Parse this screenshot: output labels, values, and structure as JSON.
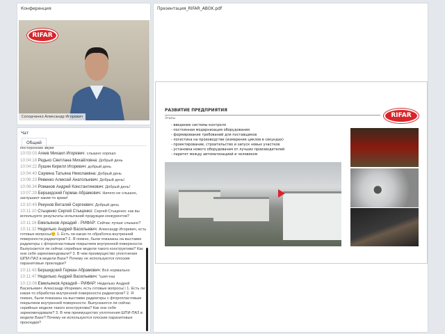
{
  "conference": {
    "title": "Конференция",
    "speaker": "Солодченко Александр Игоревич",
    "logo": "RIFAR"
  },
  "chat": {
    "title": "Чат",
    "tab": "Общий",
    "top_fragment": "посторонние звуки",
    "messages": [
      {
        "time": "10:03:03",
        "name": "Агеев Михаил Игоревич:",
        "text": "слышно хорошо"
      },
      {
        "time": "10:04:18",
        "name": "Редько Светлана Михайловна:",
        "text": "Добрый день"
      },
      {
        "time": "10:04:22",
        "name": "Лушин Кирилл Игоревич:",
        "text": "добрый день"
      },
      {
        "time": "10:04:40",
        "name": "Саукина Татьяна Николаевна:",
        "text": "Добрый день"
      },
      {
        "time": "10:06:23",
        "name": "Ревенко Алексей Анатольевич:",
        "text": "Добрый день!"
      },
      {
        "time": "10:06:34",
        "name": "Романов Андрей Константинович:",
        "text": "Добрый день!"
      },
      {
        "time": "10:07:29",
        "name": "Бершидский Герман Абрамович:",
        "text": "Ничего не слышно, заглушают какие-то крики!"
      },
      {
        "time": "10:10:49",
        "name": "Рекунов Виталий Сергеевич:",
        "text": "Добрый день"
      },
      {
        "time": "10:11:10",
        "name": "Стыценко Сергей Стыценко:",
        "text": "Сергей Стыценко: как вы используете результаты испытаний продукции конкурентов?"
      },
      {
        "time": "10:11:16",
        "name": "Емельянов Аркадий - РИФАР:",
        "text": "Сейчас лучше слышно?"
      },
      {
        "time": "10:11:32",
        "name": "Недилько Андрей Васильевич:",
        "text": "Александр Игоревич, есть готовые вопросы😊 1. Есть ли какая-то обработка внутренней поверхности радиаторов? 2. Я помню, были показаны на выставке радиаторы с фторопластовым покрытием внутренней поверхности. Выпускаются ли сейчас серийные модели такого конструктива? Как они себя зарекомендовали? 3. В чем преимущество уплотнения ШПИ-ПАЗ в модели Base? Почему не используются плоские паранитовые прокладки?"
      },
      {
        "time": "10:11:43",
        "name": "Бершидский Герман Абрамович:",
        "text": "Всё нормально"
      },
      {
        "time": "10:11:47",
        "name": "Недилько Андрей Васильевич:",
        "text": "*шип-паз"
      },
      {
        "time": "10:13:08",
        "name": "Емельянов Аркадий - РИФАР:",
        "text": "Недилько Андрей Васильевич: Александр Игоревич, есть готовые вопросы□ 1. Есть ли какая-то обработка внутренней поверхности радиаторов? 2. Я помню, были показаны на выставке радиаторы с фторопластовым покрытием внутренней поверхности. Выпускаются ли сейчас серийные модели такого конструктива? Как они себя зарекомендовали? 3. В чем преимущество уплотнения ШПИ-ПАЗ в модели Base? Почему не используются плоские паранитовые прокладки?"
      }
    ]
  },
  "presentation": {
    "title": "Презентация_RIFAR_ABOK.pdf",
    "slide": {
      "heading": "РАЗВИТИЕ ПРЕДПРИЯТИЯ",
      "subheading": "Этапы",
      "logo": "RIFAR",
      "bullets": [
        "- введение системы контроля",
        "- постоянная модернизация оборудования",
        "- формирование требований для поставщиков",
        "- логистика на производстве (измерение циклов в секундах)",
        "- проектирование, строительство и запуск новых участков",
        "- установка нового оборудования от лучших производителей",
        "- паритет между автоматизацией и человеком"
      ]
    }
  }
}
